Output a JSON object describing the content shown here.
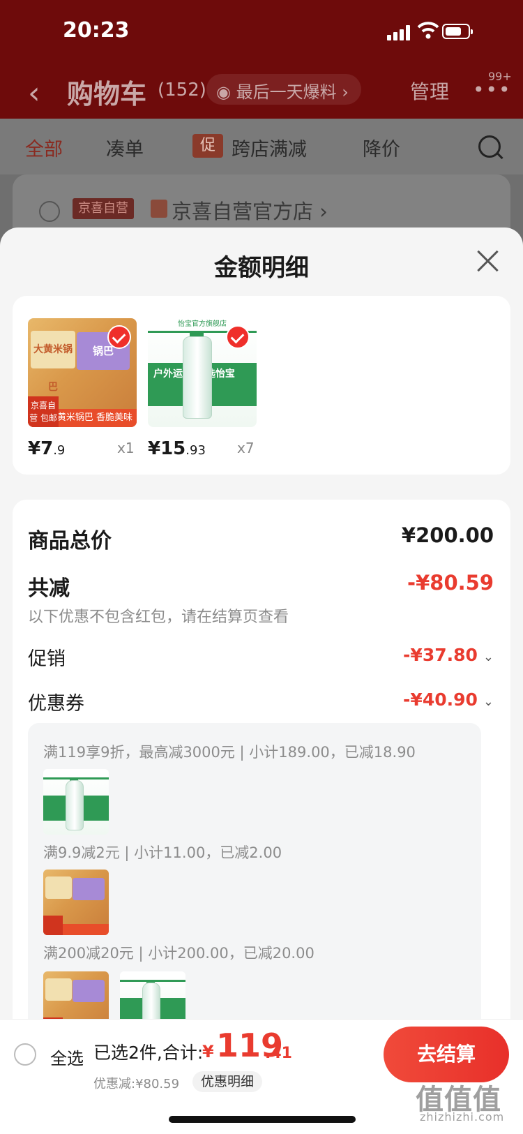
{
  "status_bar": {
    "time": "20:23"
  },
  "header": {
    "back_icon": "chevron-left-icon",
    "title": "购物车",
    "count": "(152)",
    "promo_pill": "最后一天爆料 ›",
    "manage": "管理",
    "more": "•••",
    "more_badge": "99+"
  },
  "filter_tabs": [
    {
      "label": "全部",
      "active": true
    },
    {
      "label": "凑单"
    },
    {
      "label": "跨店满减",
      "tag": "促"
    },
    {
      "label": "降价"
    }
  ],
  "store": {
    "tag": "京喜自营",
    "name": "京喜自营官方店 ›"
  },
  "sheet": {
    "title": "金额明细",
    "products": [
      {
        "name": "大黄米锅巴",
        "image_text": "大黄米锅巴",
        "image_side": "锅巴",
        "bar": "大黄米锅巴 香脆美味",
        "ribbon": "京喜自营 包邮",
        "price_int": "¥7",
        "price_dec": ".9",
        "qty": "x1"
      },
      {
        "name": "怡宝",
        "image_top": "怡宝官方旗舰店",
        "image_text": "户外运动 首选怡宝",
        "price_int": "¥15",
        "price_dec": ".93",
        "qty": "x7"
      }
    ],
    "total_label": "商品总价",
    "total_value": "¥200.00",
    "reduce_label": "共减",
    "reduce_value": "-¥80.59",
    "reduce_note": "以下优惠不包含红包，请在结算页查看",
    "promo_label": "促销",
    "promo_value": "-¥37.80",
    "coupon_label": "优惠券",
    "coupon_value": "-¥40.90",
    "rules": [
      "满119享9折，最高减3000元 | 小计189.00，已减18.90",
      "满9.9减2元 | 小计11.00，已减2.00",
      "满200减20元 | 小计200.00，已减20.00"
    ]
  },
  "bottom_bar": {
    "select_all": "全选",
    "selected_text": "已选2件,合计:",
    "total_symbol": "¥",
    "total_int": "119",
    "total_dec": ".41",
    "discount": "优惠减:¥80.59",
    "detail_button": "优惠明细",
    "checkout": "去结算"
  },
  "watermark": {
    "text": "值值值",
    "url": "zhizhizhi.com"
  },
  "colors": {
    "accent": "#e93b2f",
    "header_bg": "#6e0b0b",
    "sheet_bg": "#f5f5f5"
  }
}
